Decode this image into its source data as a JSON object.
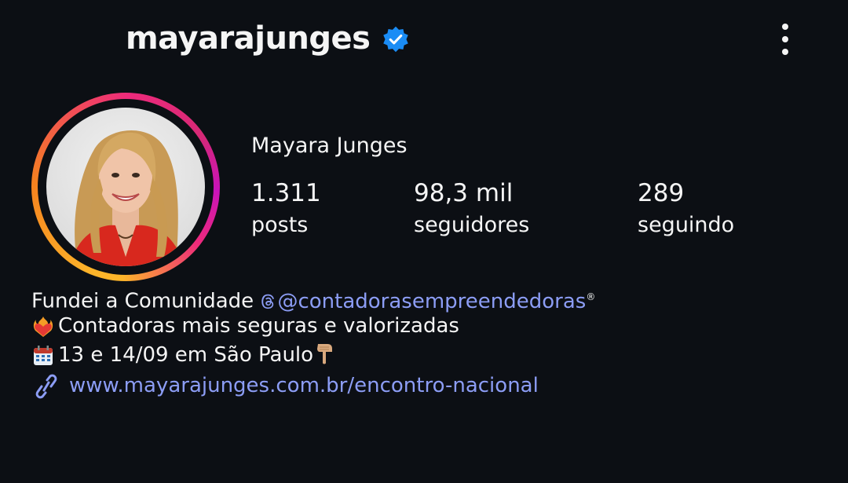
{
  "header": {
    "username": "mayarajunges",
    "verified_icon": "verified-badge-icon",
    "menu_icon": "more-vertical-icon"
  },
  "profile": {
    "display_name": "Mayara Junges",
    "avatar": "profile-photo",
    "stats": [
      {
        "value": "1.311",
        "label": "posts"
      },
      {
        "value": "98,3 mil",
        "label": "seguidores"
      },
      {
        "value": "289",
        "label": "seguindo"
      }
    ]
  },
  "bio": {
    "line1_prefix": "Fundei a Comunidade ",
    "line1_mention": "@contadorasempreendedoras",
    "line1_mention_icon": "threads-icon",
    "line1_suffix": "®",
    "line2_emoji": "heart-on-fire-icon",
    "line2_text": "Contadoras mais seguras e valorizadas",
    "line3_emoji": "calendar-icon",
    "line3_text": "13 e 14/09 em São Paulo",
    "line3_trailing_emoji": "pointing-down-icon",
    "link_icon": "link-icon",
    "link_text": "www.mayarajunges.com.br/encontro-nacional"
  },
  "colors": {
    "background": "#0c0f14",
    "text": "#f5f5f5",
    "link": "#8c9df5",
    "verified": "#1a8cf5"
  }
}
